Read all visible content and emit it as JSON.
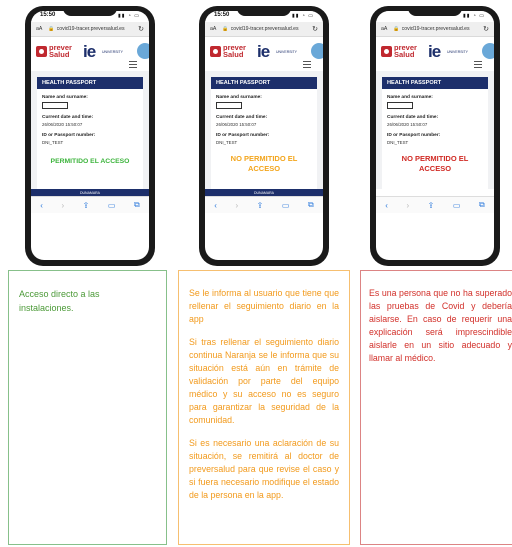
{
  "phone_ui": {
    "time": "15:50",
    "url": "covid19-tracer.preversalud.es",
    "aa": "aA",
    "brand_line1": "prever",
    "brand_line2": "Salud",
    "ie_logo": "ie",
    "ie_subtitle": "UNIVERSITY",
    "card_title": "HEALTH PASSPORT",
    "name_label": "Name and surname:",
    "date_label": "Current date and time:",
    "date_value": "26/06/2020 15:50:07",
    "id_label": "ID or Passport number:",
    "id_value": "DNI_TEST",
    "bottom_strip": "DUNAMARA"
  },
  "phones": [
    {
      "status_line1": "PERMITIDO EL ACCESO",
      "status_line2": "",
      "status_color": "#3cb43c"
    },
    {
      "status_line1": "NO PERMITIDO EL",
      "status_line2": "ACCESO",
      "status_color": "#f3a51c"
    },
    {
      "status_line1": "NO PERMITIDO EL",
      "status_line2": "ACCESO",
      "status_color": "#d02a24"
    }
  ],
  "toolbar_icons": [
    "back-arrow-icon",
    "forward-arrow-icon",
    "share-icon",
    "book-icon",
    "tabs-icon"
  ],
  "panels": {
    "green": {
      "color": "#4c9a38",
      "text": "Acceso directo a las instalaciones."
    },
    "orange": {
      "color": "#f29a1c",
      "p1": "Se le informa al usuario que tiene que rellenar el seguimiento diario en la app",
      "p2": "Si tras rellenar el seguimiento diario continua Naranja se le informa que su situación está aún en trámite de validación por parte del equipo médico y su acceso no es seguro para garantizar la seguridad de la comunidad.",
      "p3": "Si es necesario una aclaración de su situación, se remitirá al doctor de preversalud para que revise el caso y si fuera necesario modifique el estado de la persona en la app."
    },
    "red": {
      "color": "#d2302a",
      "text": "Es una persona que no ha superado las pruebas de Covid y debería aislarse. En caso de requerir una explicación será imprescindible aislarle en un sitio adecuado y llamar al médico."
    }
  }
}
